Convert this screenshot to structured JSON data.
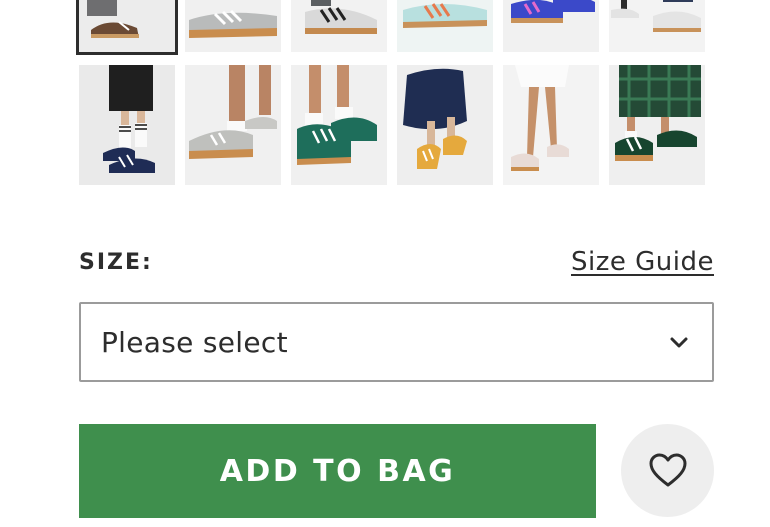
{
  "gallery": {
    "thumbnails": [
      {
        "name": "thumb-1",
        "selected": true
      },
      {
        "name": "thumb-2",
        "selected": false
      },
      {
        "name": "thumb-3",
        "selected": false
      },
      {
        "name": "thumb-4",
        "selected": false
      },
      {
        "name": "thumb-5",
        "selected": false
      },
      {
        "name": "thumb-6",
        "selected": false
      },
      {
        "name": "thumb-7",
        "selected": false
      },
      {
        "name": "thumb-8",
        "selected": false
      },
      {
        "name": "thumb-9",
        "selected": false
      },
      {
        "name": "thumb-10",
        "selected": false
      },
      {
        "name": "thumb-11",
        "selected": false
      },
      {
        "name": "thumb-12",
        "selected": false
      }
    ]
  },
  "size": {
    "label": "SIZE:",
    "guide_link": "Size Guide",
    "select_value": "Please select"
  },
  "actions": {
    "add_to_bag": "ADD TO BAG",
    "save_icon": "heart-icon"
  },
  "colors": {
    "accent_green": "#3f8f4d",
    "text": "#2d2d2d"
  }
}
